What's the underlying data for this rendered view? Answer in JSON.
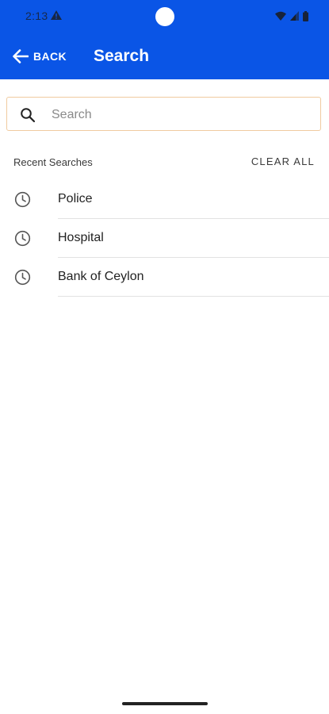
{
  "status_bar": {
    "time": "2:13",
    "icons": [
      "warning-icon",
      "wifi-icon",
      "signal-icon",
      "battery-icon"
    ]
  },
  "app_bar": {
    "back_label": "BACK",
    "title": "Search",
    "background_color": "#0a55e6"
  },
  "search": {
    "placeholder": "Search",
    "value": "",
    "border_color": "#f0cba0"
  },
  "recent": {
    "title": "Recent Searches",
    "clear_label": "CLEAR ALL",
    "items": [
      {
        "label": "Police",
        "icon": "clock-icon"
      },
      {
        "label": "Hospital",
        "icon": "clock-icon"
      },
      {
        "label": "Bank of Ceylon",
        "icon": "clock-icon"
      }
    ]
  }
}
